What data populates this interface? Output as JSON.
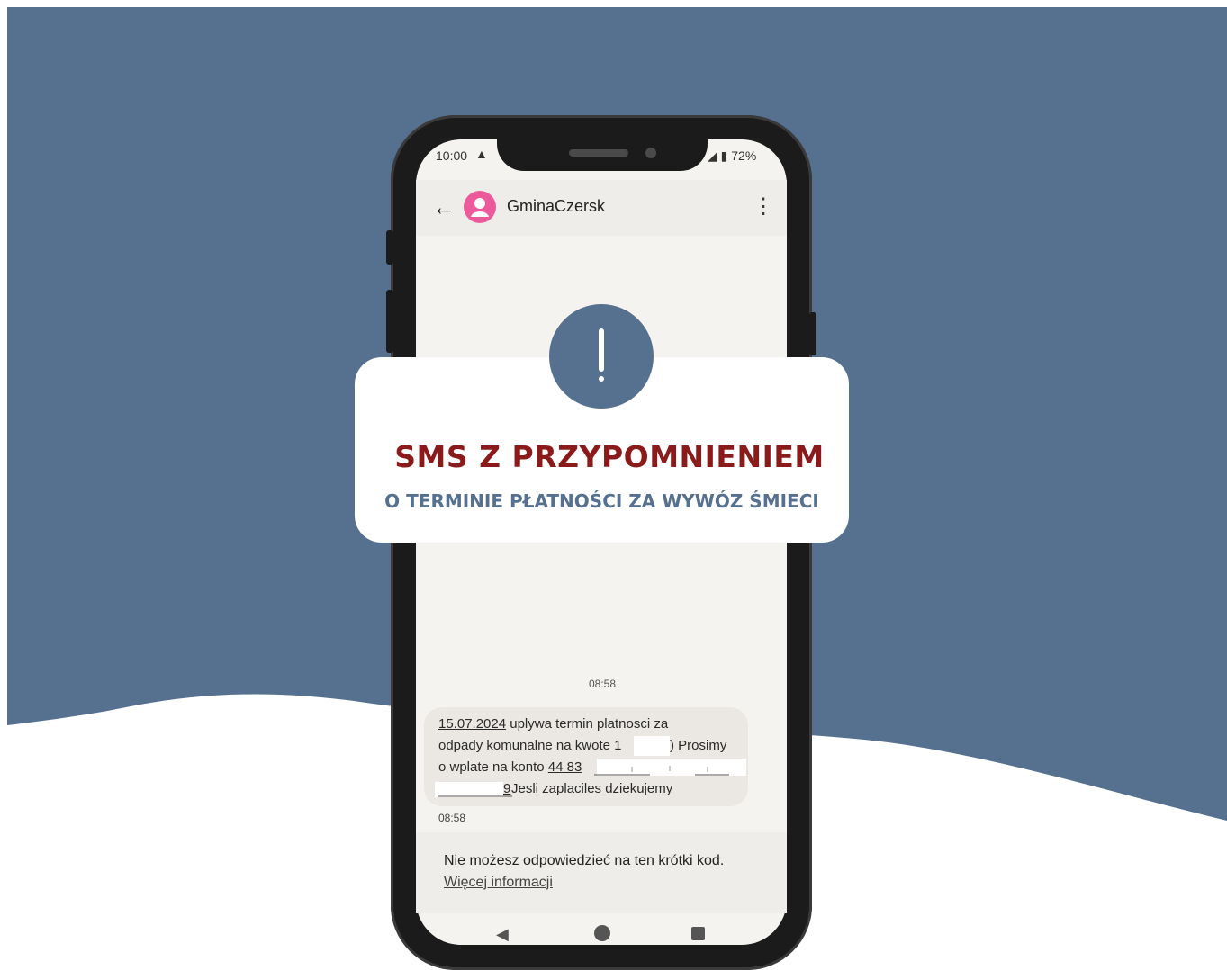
{
  "colors": {
    "background_blue": "#56708f",
    "title_red": "#8b1a1a",
    "avatar_pink": "#ec5a9b"
  },
  "status_bar": {
    "time": "10:00",
    "warning_icon": "warning-triangle-icon",
    "signal_battery": "◢ ▮ 72%"
  },
  "app_bar": {
    "back_icon": "←",
    "contact_name": "GminaCzersk",
    "menu_icon": "⋮"
  },
  "card": {
    "title": "SMS Z PRZYPOMNIENIEM",
    "subtitle": "O TERMINIE PŁATNOŚCI ZA WYWÓZ ŚMIECI"
  },
  "message": {
    "time_header": "08:58",
    "date": "15.07.2024",
    "line1_rest": " uplywa termin platnosci za",
    "line2_a": "odpady komunalne na kwote 1",
    "line2_b": ") Prosimy",
    "line3_a": "o wplate na konto ",
    "line3_account": "44 83",
    "line4_digit": "9",
    "line4_rest": " Jesli zaplaciles dziekujemy",
    "time_footer": "08:58"
  },
  "reply": {
    "notice": "Nie możesz odpowiedzieć na ten krótki kod.",
    "more_info": "Więcej informacji"
  },
  "nav": {
    "back": "◀"
  }
}
